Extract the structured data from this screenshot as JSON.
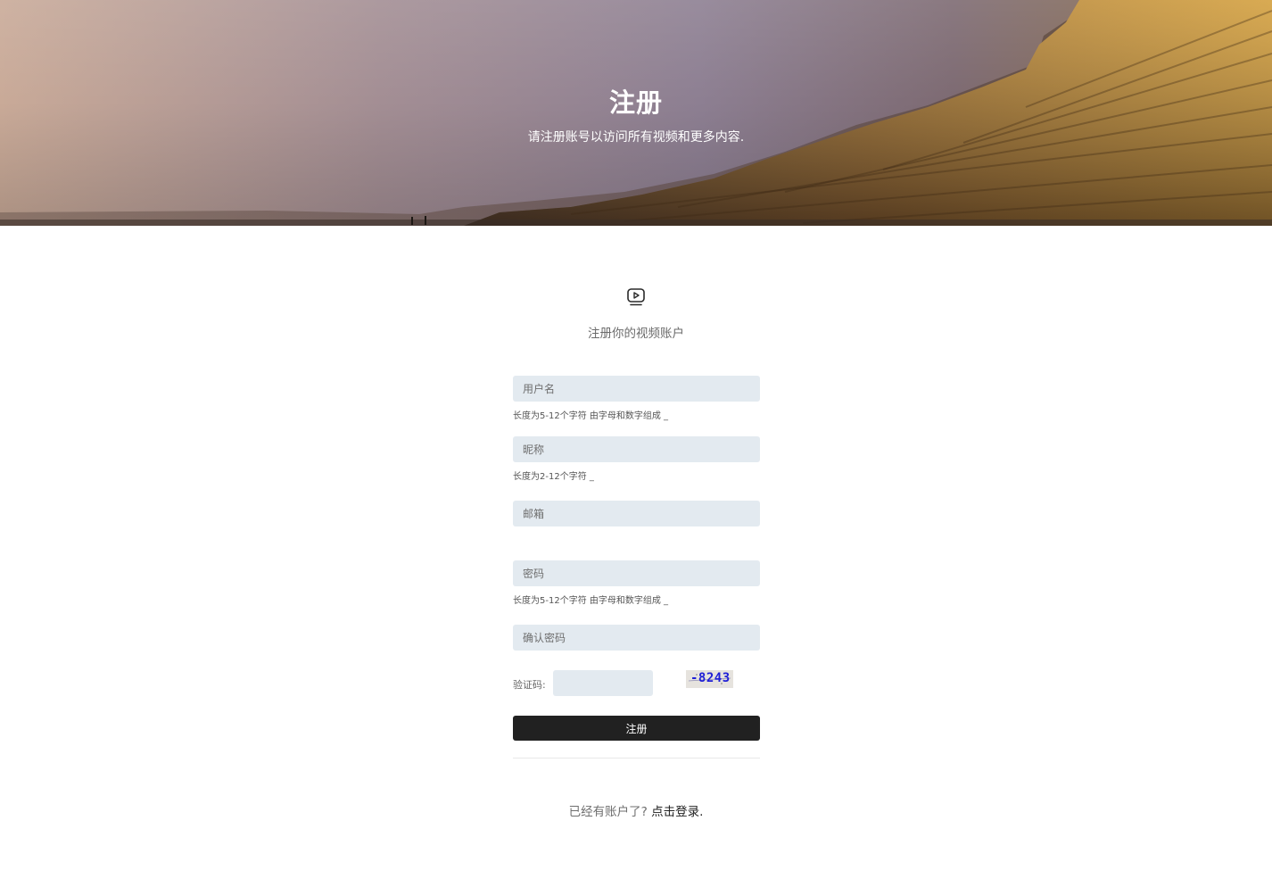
{
  "hero": {
    "title": "注册",
    "subtitle": "请注册账号以访问所有视频和更多内容."
  },
  "form": {
    "logo_icon": "tv-play-icon",
    "heading": "注册你的视频账户",
    "username": {
      "placeholder": "用户名",
      "value": "",
      "hint": "长度为5-12个字符 由字母和数字组成 _"
    },
    "nickname": {
      "placeholder": "昵称",
      "value": "",
      "hint": "长度为2-12个字符 _"
    },
    "email": {
      "placeholder": "邮箱",
      "value": ""
    },
    "password": {
      "placeholder": "密码",
      "value": "",
      "hint": "长度为5-12个字符 由字母和数字组成 _"
    },
    "confirm_password": {
      "placeholder": "确认密码",
      "value": ""
    },
    "captcha": {
      "label": "验证码:",
      "value": "",
      "image_text": "-8243"
    },
    "submit_label": "注册"
  },
  "footer": {
    "prompt": "已经有账户了?",
    "login_link": "点击登录."
  },
  "colors": {
    "field_bg": "#e3eaf0",
    "button_bg": "#212121",
    "captcha_text": "#1f1fd6"
  }
}
